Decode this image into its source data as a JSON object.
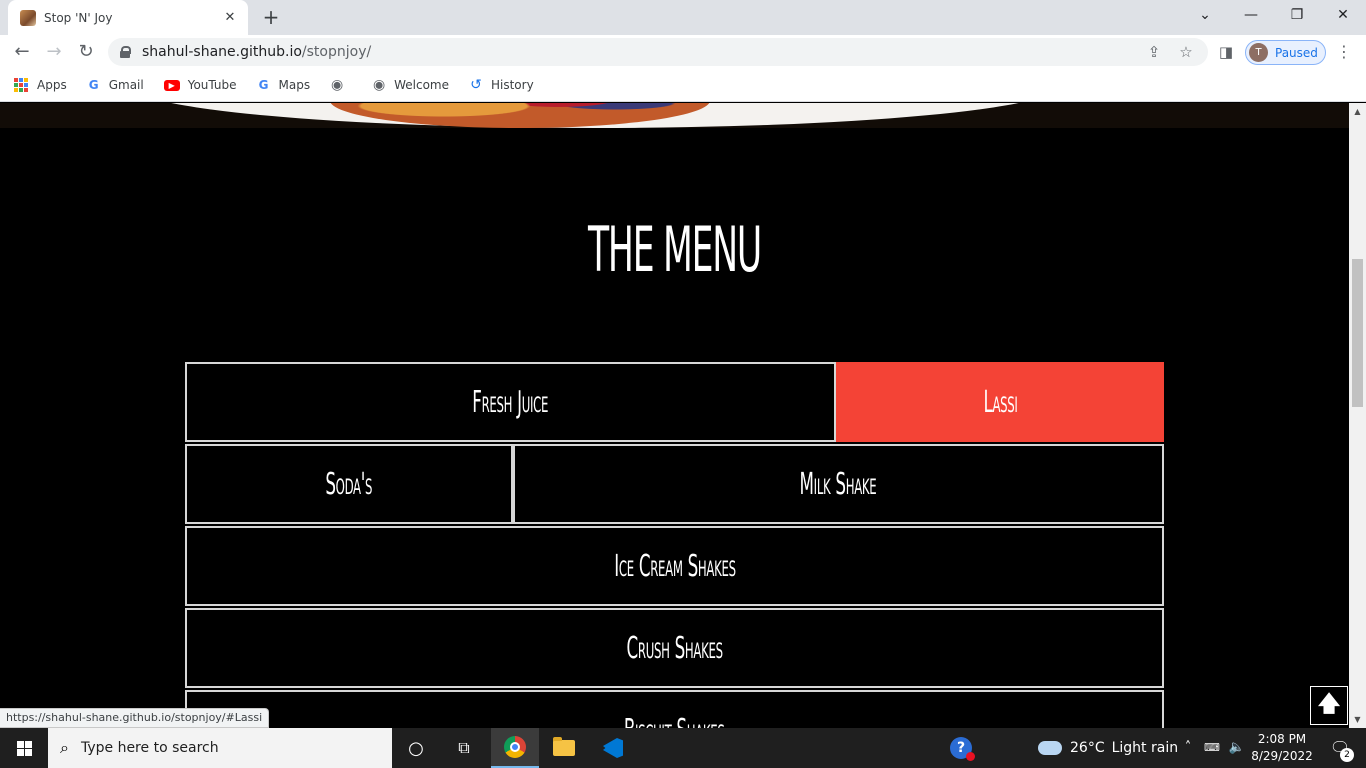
{
  "browser": {
    "tab_title": "Stop 'N' Joy",
    "tab_close": "✕",
    "new_tab": "+",
    "url_host": "shahul-shane.github.io",
    "url_path": "/stopnjoy/",
    "profile_initial": "T",
    "profile_status": "Paused",
    "window_controls": {
      "dropdown": "⌄",
      "minimize": "—",
      "restore": "❐",
      "close": "✕"
    },
    "nav": {
      "back": "←",
      "forward": "→",
      "reload": "↻"
    },
    "bookmarks": [
      {
        "label": "Apps",
        "icon": "apps-grid-icon"
      },
      {
        "label": "Gmail",
        "icon": "google-icon"
      },
      {
        "label": "YouTube",
        "icon": "youtube-icon"
      },
      {
        "label": "Maps",
        "icon": "google-icon"
      },
      {
        "label": "",
        "icon": "globe-icon"
      },
      {
        "label": "Welcome",
        "icon": "globe-icon"
      },
      {
        "label": "History",
        "icon": "history-icon"
      }
    ]
  },
  "page": {
    "menu_title": "THE MENU",
    "menu_rows": [
      [
        {
          "label": "Fresh Juice",
          "active": false,
          "flex": 2
        },
        {
          "label": "Lassi",
          "active": true,
          "flex": 1
        }
      ],
      [
        {
          "label": "Soda's",
          "active": false,
          "flex": 1
        },
        {
          "label": "Milk Shake",
          "active": false,
          "flex": 2
        }
      ],
      [
        {
          "label": "Ice Cream Shakes",
          "active": false,
          "flex": 1
        }
      ],
      [
        {
          "label": "Crush Shakes",
          "active": false,
          "flex": 1
        }
      ],
      [
        {
          "label": "Biscuit Shakes",
          "active": false,
          "flex": 1
        }
      ]
    ],
    "scroll_top_icon": "arrow-up-icon",
    "scroll_top_glyph": "🡅",
    "status_url": "https://shahul-shane.github.io/stopnjoy/#Lassi",
    "accent_color": "#f44336"
  },
  "taskbar": {
    "search_placeholder": "Type here to search",
    "weather_temp": "26°C",
    "weather_desc": "Light rain",
    "time": "2:08 PM",
    "date": "8/29/2022",
    "notification_count": "2"
  }
}
